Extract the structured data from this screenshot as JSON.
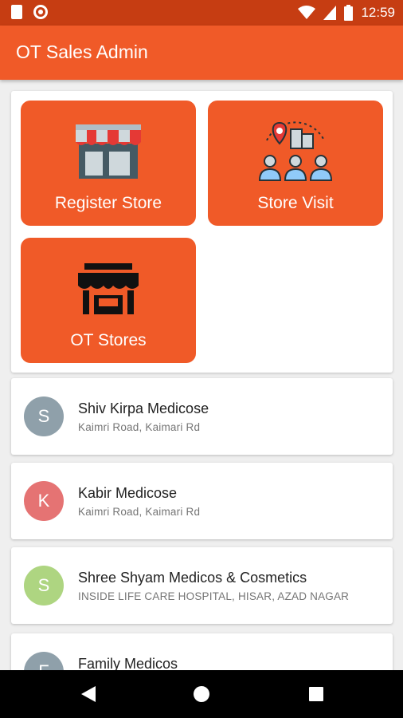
{
  "status_bar": {
    "time": "12:59",
    "icons": [
      "document-icon",
      "record-icon",
      "wifi-icon",
      "signal-icon",
      "battery-icon"
    ]
  },
  "app_bar": {
    "title": "OT Sales Admin"
  },
  "colors": {
    "accent": "#f05a28",
    "status_bar": "#c63d12"
  },
  "tiles": [
    {
      "label": "Register Store",
      "icon": "storefront-icon"
    },
    {
      "label": "Store Visit",
      "icon": "store-visit-icon"
    },
    {
      "label": "OT Stores",
      "icon": "shop-icon"
    }
  ],
  "stores": [
    {
      "initial": "S",
      "name": "Shiv Kirpa Medicose",
      "address": "Kaimri Road, Kaimari Rd",
      "color": "#8fa0aa"
    },
    {
      "initial": "K",
      "name": "Kabir Medicose",
      "address": "Kaimri Road, Kaimari Rd",
      "color": "#e57373"
    },
    {
      "initial": "S",
      "name": "Shree Shyam Medicos & Cosmetics",
      "address": "INSIDE LIFE CARE HOSPITAL, HISAR, AZAD NAGAR",
      "color": "#aed581"
    },
    {
      "initial": "F",
      "name": "Family Medicos",
      "address": "",
      "color": "#8fa0aa"
    }
  ],
  "nav": [
    "back-icon",
    "home-icon",
    "recents-icon"
  ]
}
